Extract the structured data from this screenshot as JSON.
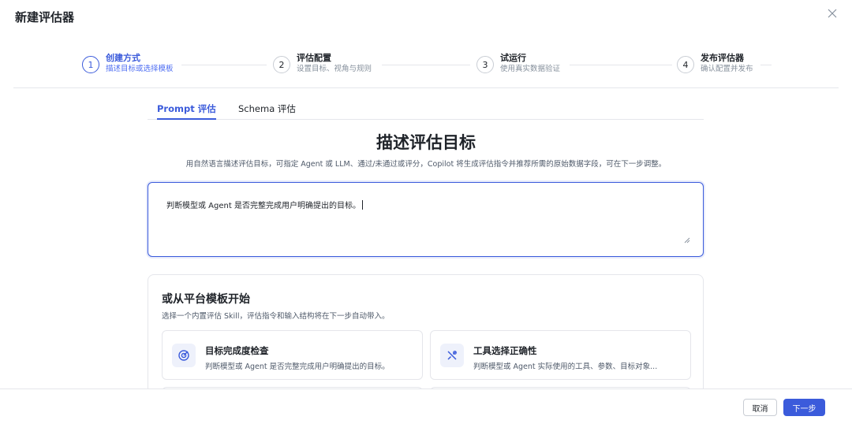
{
  "modal": {
    "title": "新建评估器"
  },
  "steps": [
    {
      "num": "1",
      "title": "创建方式",
      "sub": "描述目标或选择模板"
    },
    {
      "num": "2",
      "title": "评估配置",
      "sub": "设置目标、视角与规则"
    },
    {
      "num": "3",
      "title": "试运行",
      "sub": "使用真实数据验证"
    },
    {
      "num": "4",
      "title": "发布评估器",
      "sub": "确认配置并发布"
    }
  ],
  "tabs": [
    {
      "label": "Prompt 评估"
    },
    {
      "label": "Schema 评估"
    }
  ],
  "hero": {
    "title": "描述评估目标",
    "subtitle": "用自然语言描述评估目标，可指定 Agent 或 LLM、通过/未通过或评分，Copilot 将生成评估指令并推荐所需的原始数据字段，可在下一步调整。"
  },
  "prompt": {
    "value": "判断模型或 Agent 是否完整完成用户明确提出的目标。"
  },
  "templates": {
    "title": "或从平台模板开始",
    "subtitle": "选择一个内置评估 Skill，评估指令和输入结构将在下一步自动带入。",
    "items": [
      {
        "name": "目标完成度检查",
        "desc": "判断模型或 Agent 是否完整完成用户明确提出的目标。",
        "icon": "target-icon"
      },
      {
        "name": "工具选择正确性",
        "desc": "判断模型或 Agent 实际使用的工具、参数、目标对象...",
        "icon": "tools-icon"
      }
    ]
  },
  "footer": {
    "cancel_label": "取消",
    "next_label": "下一步"
  },
  "colors": {
    "accent": "#3b5bdb",
    "border": "#e5e6eb",
    "muted": "#86909c"
  }
}
